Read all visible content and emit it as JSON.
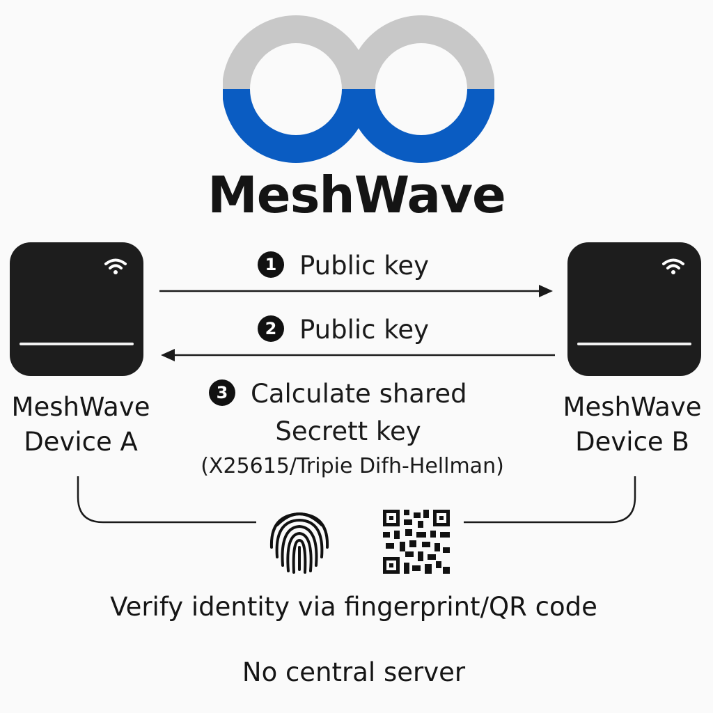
{
  "brand": {
    "name": "MeshWave",
    "colors": {
      "logo_top": "#c8c8c8",
      "logo_bottom": "#0a5cc2",
      "text": "#141414"
    }
  },
  "devices": [
    {
      "line1": "MeshWave",
      "line2": "Device A",
      "icon": "wifi-icon"
    },
    {
      "line1": "MeshWave",
      "line2": "Device B",
      "icon": "wifi-icon"
    }
  ],
  "steps": [
    {
      "number": "1",
      "label": "Public key",
      "direction": "A-to-B"
    },
    {
      "number": "2",
      "label": "Public key",
      "direction": "B-to-A"
    },
    {
      "number": "3",
      "label_line1": "Calculate shared",
      "label_line2": "Secrett key",
      "note": "(X25615/Tripie Difh-Hellman)"
    }
  ],
  "verification": {
    "icons": [
      "fingerprint-icon",
      "qr-code-icon"
    ],
    "text": "Verify identity via fingerprint/QR code"
  },
  "footer": {
    "text": "No central server"
  }
}
